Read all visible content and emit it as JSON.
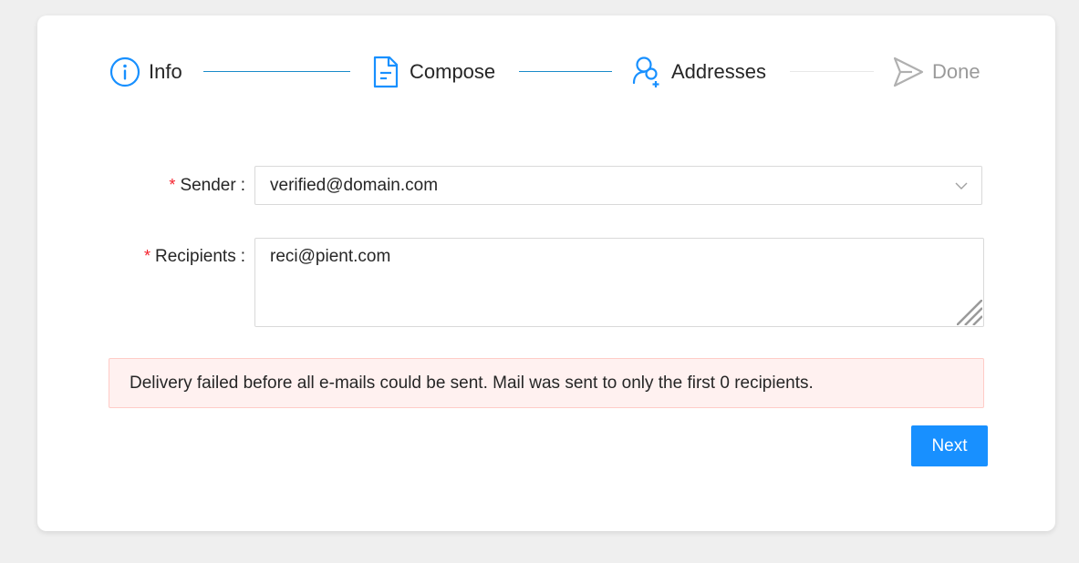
{
  "steps": [
    {
      "label": "Info",
      "icon": "info-circle-icon",
      "state": "finished"
    },
    {
      "label": "Compose",
      "icon": "file-text-icon",
      "state": "finished"
    },
    {
      "label": "Addresses",
      "icon": "user-add-icon",
      "state": "current"
    },
    {
      "label": "Done",
      "icon": "send-icon",
      "state": "waiting"
    }
  ],
  "colors": {
    "accent": "#1890ff",
    "connector_done": "#1a8bc9",
    "connector_pending": "#e8e8e8",
    "required": "#f5222d",
    "alert_bg": "#fff1f0",
    "alert_border": "#ffccc7"
  },
  "form": {
    "sender": {
      "label": "Sender",
      "required_mark": "*",
      "value": "verified@domain.com"
    },
    "recipients": {
      "label": "Recipients",
      "required_mark": "*",
      "value": "reci@pient.com"
    }
  },
  "alert": {
    "message": "Delivery failed before all e-mails could be sent. Mail was sent to only the first 0 recipients."
  },
  "actions": {
    "next_label": "Next"
  }
}
